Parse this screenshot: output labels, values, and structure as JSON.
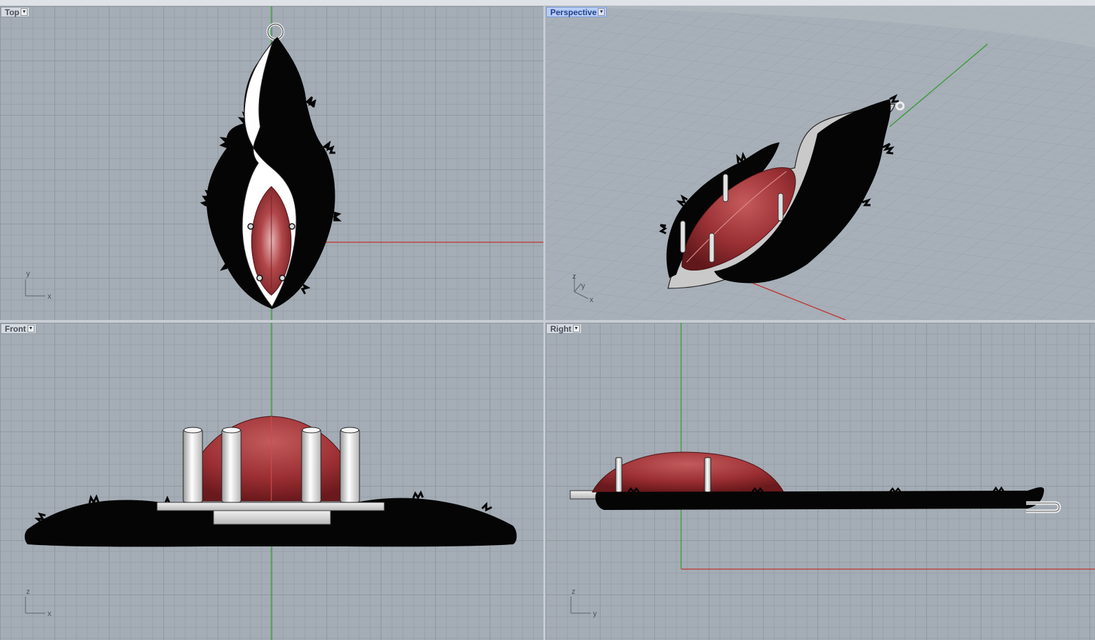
{
  "viewports": {
    "top": {
      "label": "Top",
      "axis_h": "x",
      "axis_v": "y"
    },
    "perspective": {
      "label": "Perspective",
      "axis_1": "x",
      "axis_2": "y",
      "axis_3": "z"
    },
    "front": {
      "label": "Front",
      "axis_h": "x",
      "axis_v": "z"
    },
    "right": {
      "label": "Right",
      "axis_h": "y",
      "axis_v": "z"
    }
  },
  "icons": {
    "viewport_menu": "dropdown-arrow-icon"
  },
  "colors": {
    "x_axis": "#c0302b",
    "y_axis": "#2e9b2e",
    "gem": "#a83a3c",
    "viewport_bg": "#a4acb5",
    "active_label": "#b7cdf5"
  }
}
